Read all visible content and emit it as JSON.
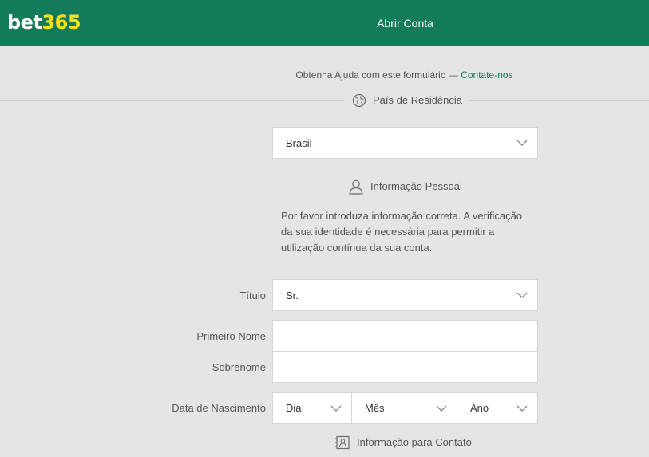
{
  "header": {
    "logo_bet": "bet",
    "logo_num": "365",
    "title": "Abrir Conta"
  },
  "help": {
    "text": "Obtenha Ajuda com este formulário — ",
    "link": "Contate-nos"
  },
  "sections": {
    "residence": {
      "title": "País de Residência",
      "icon": "globe-icon"
    },
    "personal": {
      "title": "Informação Pessoal",
      "icon": "person-icon"
    },
    "contact": {
      "title": "Informação para Contato",
      "icon": "contact-card-icon"
    }
  },
  "country_select": {
    "value": "Brasil"
  },
  "personal_info": {
    "notice": "Por favor introduza informação correta. A verificação da sua identidade é necessária para permitir a utilização contínua da sua conta.",
    "title_label": "Título",
    "title_value": "Sr.",
    "first_name_label": "Primeiro Nome",
    "first_name_value": "",
    "last_name_label": "Sobrenome",
    "last_name_value": "",
    "dob_label": "Data de Nascimento",
    "dob_day": "Dia",
    "dob_month": "Mês",
    "dob_year": "Ano"
  },
  "colors": {
    "brand_green": "#137a5a",
    "brand_yellow": "#ffdf1b",
    "background": "#e5e5e5"
  }
}
